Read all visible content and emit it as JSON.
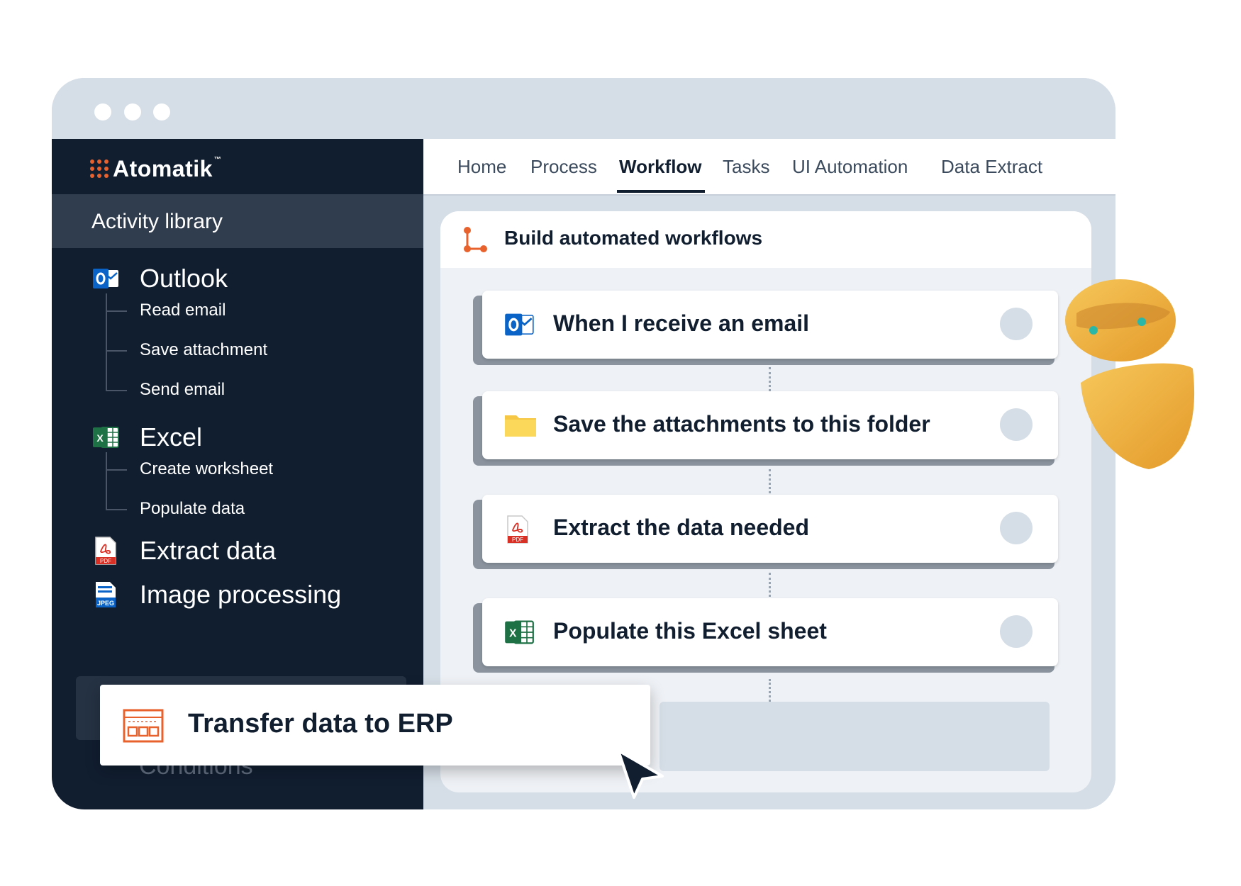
{
  "logo": {
    "name": "Atomatik",
    "tm": "™"
  },
  "tabs": [
    "Home",
    "Process",
    "Workflow",
    "Tasks",
    "UI Automation",
    "Data Extract"
  ],
  "active_tab": "Workflow",
  "sidebar": {
    "header": "Activity library",
    "groups": [
      {
        "label": "Outlook",
        "icon": "outlook-icon",
        "items": [
          "Read email",
          "Save attachment",
          "Send email"
        ]
      },
      {
        "label": "Excel",
        "icon": "excel-icon",
        "items": [
          "Create worksheet",
          "Populate data"
        ]
      },
      {
        "label": "Extract data",
        "icon": "pdf-icon",
        "items": []
      },
      {
        "label": "Image processing",
        "icon": "jpeg-icon",
        "items": []
      }
    ],
    "ghost_label": "Conditions"
  },
  "panel": {
    "title": "Build automated workflows",
    "steps": [
      {
        "label": "When I receive an email",
        "icon": "outlook-icon"
      },
      {
        "label": "Save the attachments to this folder",
        "icon": "folder-icon"
      },
      {
        "label": "Extract the data needed",
        "icon": "pdf-icon"
      },
      {
        "label": "Populate this Excel sheet",
        "icon": "excel-icon"
      }
    ]
  },
  "drag_item": {
    "label": "Transfer data to ERP",
    "icon": "erp-window-icon"
  },
  "colors": {
    "sidebar": "#111e30",
    "accent": "#e8622e",
    "window": "#d5dde6"
  }
}
